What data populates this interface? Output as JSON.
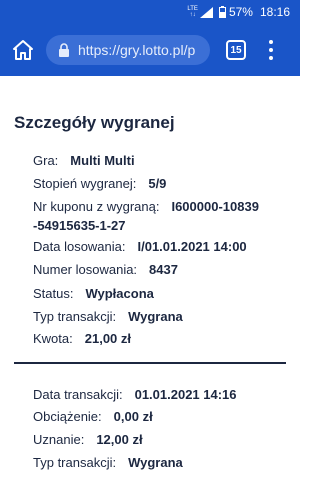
{
  "status_bar": {
    "network": "LTE",
    "battery": "57%",
    "time": "18:16"
  },
  "browser": {
    "url": "https://gry.lotto.pl/p",
    "tab_count": "15",
    "icons": [
      "home-icon",
      "lock-icon",
      "tabs-icon",
      "menu-icon"
    ]
  },
  "page": {
    "title": "Szczegóły wygranej"
  },
  "win_details": [
    {
      "label": "Gra:",
      "value": "Multi Multi"
    },
    {
      "label": "Stopień wygranej:",
      "value": "5/9"
    },
    {
      "label": "Nr kuponu z wygraną:",
      "value": "I600000-10839-54915635-1-27"
    },
    {
      "label": "Data losowania:",
      "value": "I/01.01.2021 14:00"
    },
    {
      "label": "Numer losowania:",
      "value": "8437"
    },
    {
      "label": "Status:",
      "value": "Wypłacona"
    },
    {
      "label": "Typ transakcji:",
      "value": "Wygrana"
    },
    {
      "label": "Kwota:",
      "value": "21,00 zł"
    }
  ],
  "transaction_details": [
    {
      "label": "Data transakcji:",
      "value": "01.01.2021 14:16"
    },
    {
      "label": "Obciążenie:",
      "value": "0,00 zł"
    },
    {
      "label": "Uznanie:",
      "value": "12,00 zł"
    },
    {
      "label": "Typ transakcji:",
      "value": "Wygrana"
    }
  ]
}
